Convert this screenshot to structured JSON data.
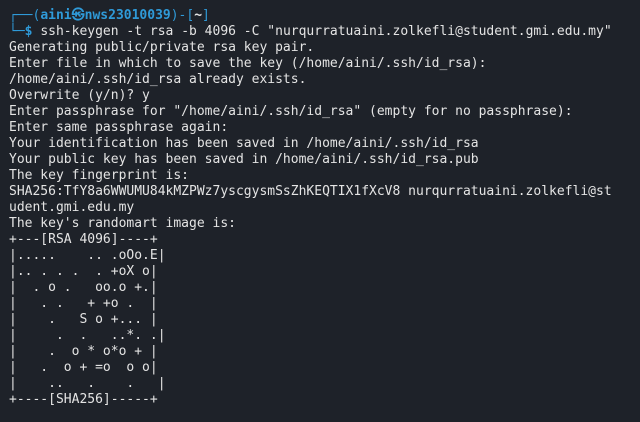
{
  "prompt": {
    "open": "┌──(",
    "user": "aini",
    "at": "㉿",
    "host": "nws23010039",
    "mid": ")-[",
    "cwd": "~",
    "close": "]",
    "corner": "└─",
    "sign": "$",
    "command": "ssh-keygen -t rsa -b 4096 -C \"nurqurratuaini.zolkefli@student.gmi.edu.my\""
  },
  "output_lines": [
    "Generating public/private rsa key pair.",
    "Enter file in which to save the key (/home/aini/.ssh/id_rsa):",
    "/home/aini/.ssh/id_rsa already exists.",
    "Overwrite (y/n)? y",
    "Enter passphrase for \"/home/aini/.ssh/id_rsa\" (empty for no passphrase):",
    "Enter same passphrase again:",
    "Your identification has been saved in /home/aini/.ssh/id_rsa",
    "Your public key has been saved in /home/aini/.ssh/id_rsa.pub",
    "The key fingerprint is:",
    "SHA256:TfY8a6WWUMU84kMZPWz7yscgysmSsZhKEQTIX1fXcV8 nurqurratuaini.zolkefli@st",
    "udent.gmi.edu.my",
    "The key's randomart image is:",
    "+---[RSA 4096]----+",
    "|.....    .. .oOo.E|",
    "|.. . . .  . +oX o|",
    "|  . o .   oo.o +.|",
    "|   . .   + +o .  |",
    "|    .   S o +... |",
    "|     .  .   ..*. .|",
    "|    .  o * o*o + |",
    "|   .  o + =o  o o|",
    "|    ..   .    .   |",
    "+----[SHA256]-----+"
  ],
  "colors": {
    "background": "#1e2229",
    "text": "#e4e4e4",
    "prompt_accent": "#2f9ad8"
  }
}
